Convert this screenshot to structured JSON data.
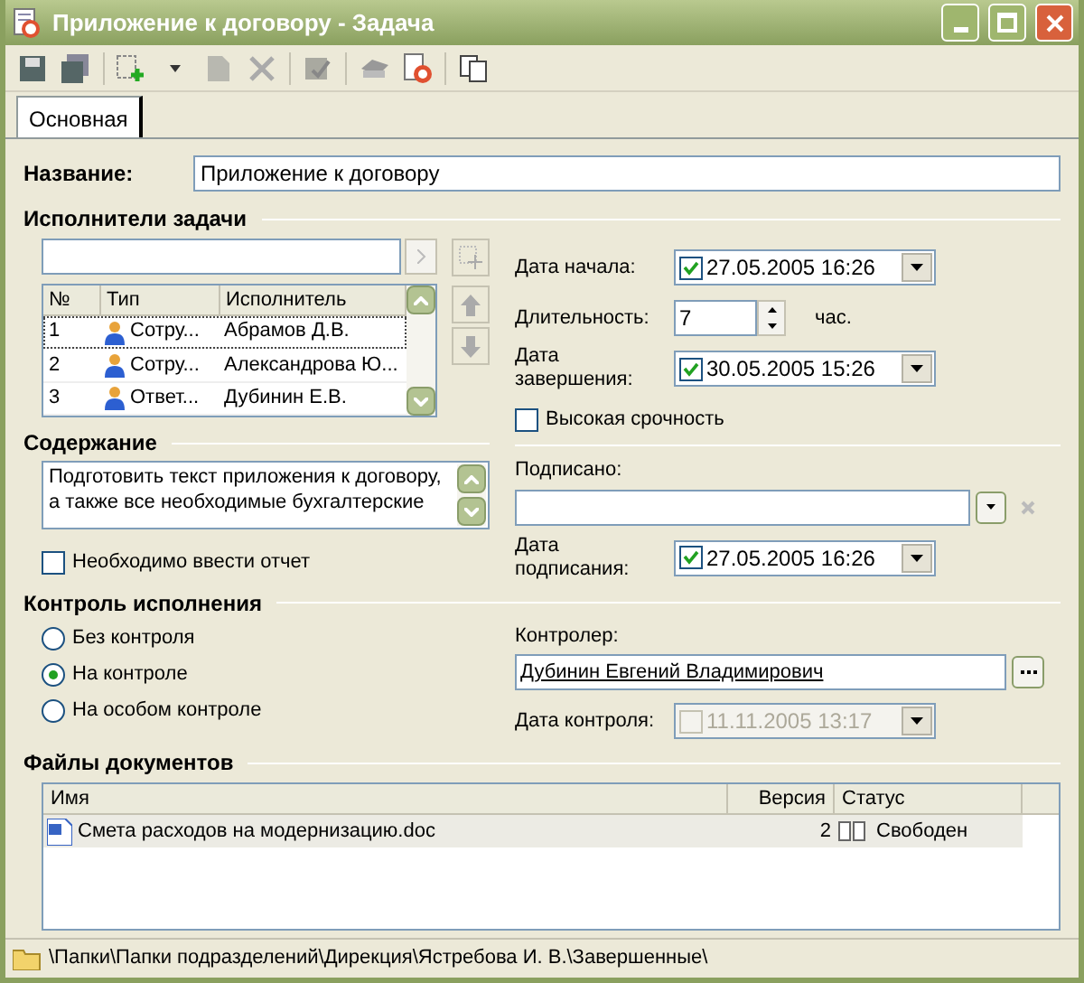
{
  "window": {
    "title": "Приложение к договору - Задача"
  },
  "tabs": [
    {
      "label": "Основная",
      "selected": true
    }
  ],
  "name_field": {
    "label": "Название:",
    "value": "Приложение к договору"
  },
  "performers": {
    "title": "Исполнители задачи",
    "columns": [
      "№",
      "Тип",
      "Исполнитель"
    ],
    "rows": [
      {
        "num": "1",
        "type": "Сотру...",
        "name": "Абрамов Д.В.",
        "selected": true
      },
      {
        "num": "2",
        "type": "Сотру...",
        "name": "Александрова Ю...",
        "selected": false
      },
      {
        "num": "3",
        "type": "Ответ...",
        "name": "Дубинин Е.В.",
        "selected": false
      }
    ]
  },
  "schedule": {
    "start": {
      "label": "Дата начала:",
      "value": "27.05.2005 16:26",
      "checked": true
    },
    "duration": {
      "label": "Длительность:",
      "value": "7",
      "unit": "час."
    },
    "end": {
      "label": "Дата завершения:",
      "value": "30.05.2005 15:26",
      "checked": true
    },
    "urgent": {
      "label": "Высокая срочность",
      "checked": false
    }
  },
  "content": {
    "title": "Содержание",
    "text": "Подготовить текст приложения к договору, а также все необходимые бухгалтерские"
  },
  "report": {
    "label": "Необходимо ввести отчет",
    "checked": false
  },
  "signed": {
    "label": "Подписано:",
    "date": {
      "label": "Дата подписания:",
      "value": "27.05.2005 16:26",
      "checked": true
    }
  },
  "control": {
    "title": "Контроль исполнения",
    "options": [
      {
        "label": "Без контроля",
        "selected": false
      },
      {
        "label": "На контроле",
        "selected": true
      },
      {
        "label": "На особом контроле",
        "selected": false
      }
    ],
    "controller": {
      "label": "Контролер:",
      "value": "Дубинин Евгений Владимирович"
    },
    "date": {
      "label": "Дата контроля:",
      "value": "11.11.2005 13:17",
      "checked": false,
      "disabled": true
    }
  },
  "files": {
    "title": "Файлы документов",
    "columns": [
      "Имя",
      "Версия",
      "Статус"
    ],
    "rows": [
      {
        "name": "Смета расходов на модернизацию.doc",
        "version": "2",
        "status": "Свободен"
      }
    ]
  },
  "status_bar": {
    "path": "\\Папки\\Папки подразделений\\Дирекция\\Ястребова И. В.\\Завершенные\\"
  }
}
